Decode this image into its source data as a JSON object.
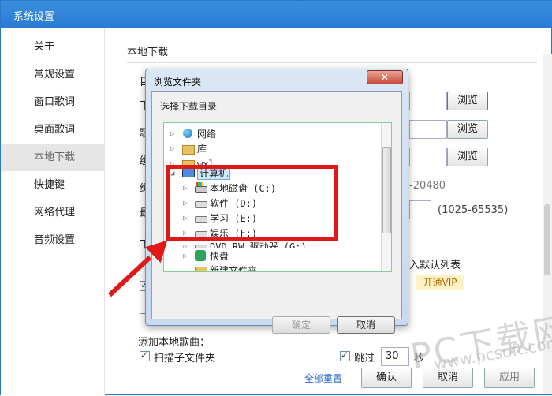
{
  "window": {
    "title": "系统设置"
  },
  "sidebar": {
    "items": [
      {
        "label": "关于",
        "active": false
      },
      {
        "label": "常规设置",
        "active": false
      },
      {
        "label": "窗口歌词",
        "active": false
      },
      {
        "label": "桌面歌词",
        "active": false
      },
      {
        "label": "本地下载",
        "active": true
      },
      {
        "label": "快捷键",
        "active": false
      },
      {
        "label": "网络代理",
        "active": false
      },
      {
        "label": "音频设置",
        "active": false
      }
    ]
  },
  "main": {
    "section_title": "本地下载",
    "browse_label": "浏览",
    "partial_labels": [
      "目",
      "下",
      "歌",
      "缓",
      "缓",
      "最",
      "下"
    ],
    "hints": {
      "cache": "-20480",
      "port_range": "(1025-65535)",
      "add_default": "入默认列表"
    },
    "vip_label": "开通VIP",
    "add_local_songs_label": "添加本地歌曲：",
    "scan_subfolders_label": "扫描子文件夹",
    "skip_label": "跳过",
    "skip_value": "30",
    "skip_suffix": "秒",
    "reset_all_label": "全部重置",
    "confirm_label": "确认",
    "cancel_label": "取消",
    "apply_label": "应用"
  },
  "dialog": {
    "title": "浏览文件夹",
    "close_label": "✕",
    "prompt": "选择下载目录",
    "tree": [
      {
        "label": "网络",
        "icon": "network-icon"
      },
      {
        "label": "库",
        "icon": "library-icon"
      },
      {
        "label": "wxl",
        "icon": "user-folder-icon"
      },
      {
        "label": "计算机",
        "icon": "computer-icon",
        "selected": true
      },
      {
        "label": "本地磁盘 (C:)",
        "icon": "system-drive-icon"
      },
      {
        "label": "软件 (D:)",
        "icon": "drive-icon"
      },
      {
        "label": "学习 (E:)",
        "icon": "drive-icon"
      },
      {
        "label": "娱乐 (F:)",
        "icon": "drive-icon"
      },
      {
        "label": "DVD RW 驱动器 (G:)",
        "icon": "dvd-drive-icon"
      },
      {
        "label": "快盘",
        "icon": "kuaipan-icon"
      },
      {
        "label": "新建文件夹",
        "icon": "folder-icon"
      }
    ],
    "ok_label": "确定",
    "cancel_label": "取消"
  },
  "watermark": {
    "main": "PC下载网",
    "sub": "www.pcsoft.com.cn"
  },
  "colors": {
    "highlight": "#e01818",
    "accent": "#2a7bd4",
    "vip": "#b06a00"
  }
}
